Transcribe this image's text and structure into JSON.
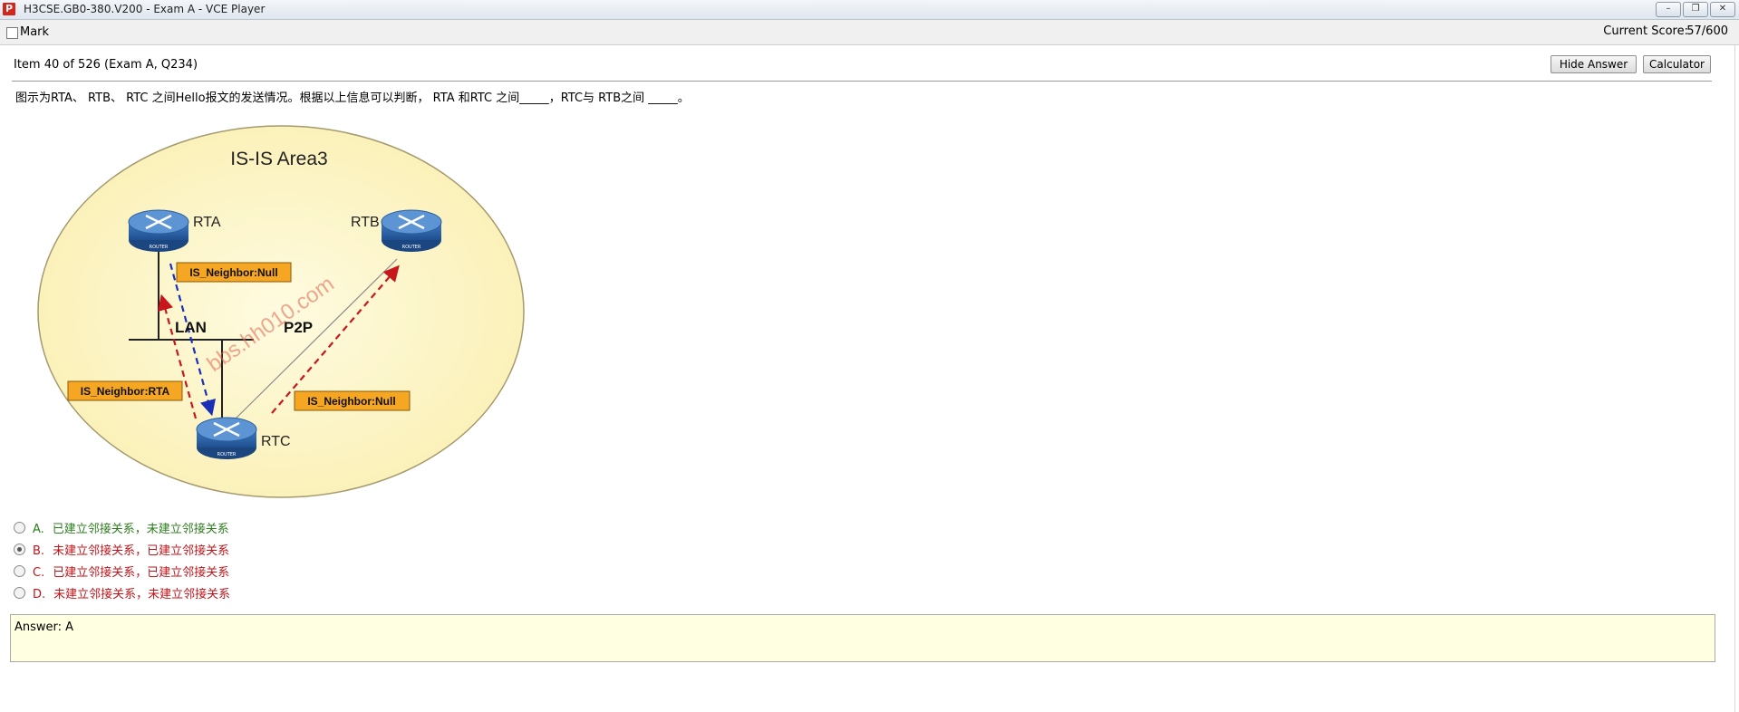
{
  "window": {
    "title": "H3CSE.GB0-380.V200 - Exam A - VCE Player",
    "app_icon": "P",
    "buttons": [
      "–",
      "❐",
      "✕"
    ]
  },
  "toolbar": {
    "mark_label": "Mark",
    "score_label": "Current Score:",
    "score_value": "57/600"
  },
  "item": {
    "info": "Item 40 of 526  (Exam A, Q234)",
    "hide_answer_label": "Hide Answer",
    "calculator_label": "Calculator"
  },
  "question": {
    "text": "图示为RTA、 RTB、 RTC 之间Hello报文的发送情况。根据以上信息可以判断， RTA 和RTC 之间_____，RTC与 RTB之间 _____。"
  },
  "diagram": {
    "area_title": "IS-IS Area3",
    "router_a": "RTA",
    "router_b": "RTB",
    "router_c": "RTC",
    "router_caption": "ROUTER",
    "lan_label": "LAN",
    "p2p_label": "P2P",
    "tag_a": "IS_Neighbor:Null",
    "tag_lan": "IS_Neighbor:RTA",
    "tag_p2p": "IS_Neighbor:Null",
    "watermark": "bbs.hh010.com",
    "colors": {
      "ellipse_fill": "#fdf5c6",
      "tag_fill": "#f5a623",
      "router": "#2c5f9e"
    }
  },
  "options": [
    {
      "letter": "A.",
      "text": "已建立邻接关系，未建立邻接关系",
      "selected": false
    },
    {
      "letter": "B.",
      "text": "未建立邻接关系，已建立邻接关系",
      "selected": true
    },
    {
      "letter": "C.",
      "text": "已建立邻接关系，已建立邻接关系",
      "selected": false
    },
    {
      "letter": "D.",
      "text": "未建立邻接关系，未建立邻接关系",
      "selected": false
    }
  ],
  "answer": {
    "text": "Answer: A"
  }
}
